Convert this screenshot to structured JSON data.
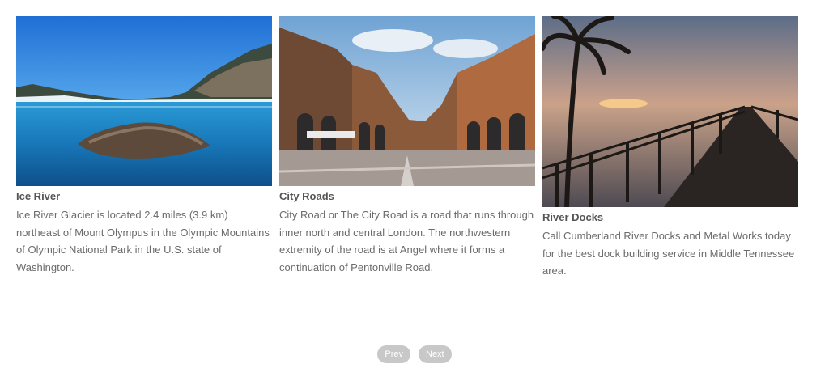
{
  "cards": [
    {
      "image": "ice-river-photo",
      "title": "Ice River",
      "description": "Ice River Glacier is located 2.4 miles (3.9 km) northeast of Mount Olympus in the Olympic Mountains of Olympic National Park in the U.S. state of Washington."
    },
    {
      "image": "city-roads-photo",
      "title": "City Roads",
      "description": "City Road or The City Road is a road that runs through inner north and central London. The northwestern extremity of the road is at Angel where it forms a continuation of Pentonville Road."
    },
    {
      "image": "river-docks-photo",
      "title": "River Docks",
      "description": "Call Cumberland River Docks and Metal Works today for the best dock building service in Middle Tennessee area."
    }
  ],
  "pagination": {
    "prev_label": "Prev",
    "next_label": "Next"
  },
  "colors": {
    "text": "#6b6b6b",
    "title": "#555555",
    "button_bg": "#c8c8c8",
    "button_text": "#ffffff"
  }
}
